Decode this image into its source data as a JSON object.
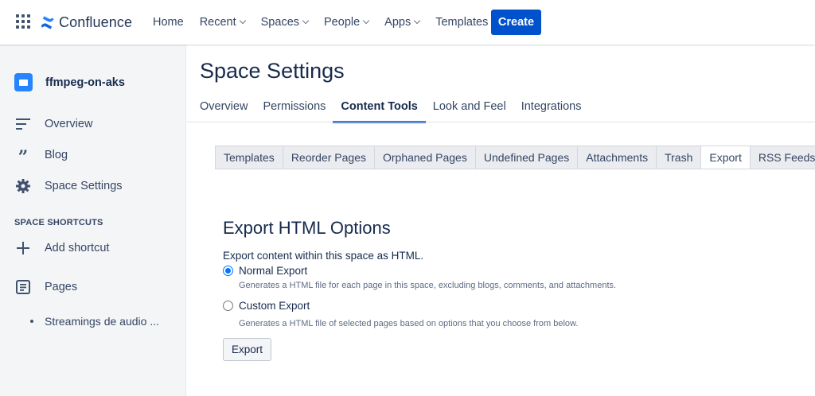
{
  "header": {
    "app_name": "Confluence",
    "nav": [
      {
        "label": "Home",
        "dropdown": false
      },
      {
        "label": "Recent",
        "dropdown": true
      },
      {
        "label": "Spaces",
        "dropdown": true
      },
      {
        "label": "People",
        "dropdown": true
      },
      {
        "label": "Apps",
        "dropdown": true
      },
      {
        "label": "Templates",
        "dropdown": false
      }
    ],
    "create_label": "Create",
    "accent": "#0052CC"
  },
  "sidebar": {
    "space_name": "ffmpeg-on-aks",
    "items": [
      {
        "label": "Overview",
        "icon": "overview-icon"
      },
      {
        "label": "Blog",
        "icon": "quote-icon"
      },
      {
        "label": "Space Settings",
        "icon": "gear-icon"
      }
    ],
    "shortcuts_heading": "SPACE SHORTCUTS",
    "add_shortcut": "Add shortcut",
    "pages_label": "Pages",
    "pages": [
      "Streamings de audio ..."
    ]
  },
  "main": {
    "title": "Space Settings",
    "tabs": [
      {
        "label": "Overview",
        "active": false
      },
      {
        "label": "Permissions",
        "active": false
      },
      {
        "label": "Content Tools",
        "active": true
      },
      {
        "label": "Look and Feel",
        "active": false
      },
      {
        "label": "Integrations",
        "active": false
      }
    ],
    "subtabs": [
      {
        "label": "Templates",
        "active": false
      },
      {
        "label": "Reorder Pages",
        "active": false
      },
      {
        "label": "Orphaned Pages",
        "active": false
      },
      {
        "label": "Undefined Pages",
        "active": false
      },
      {
        "label": "Attachments",
        "active": false
      },
      {
        "label": "Trash",
        "active": false
      },
      {
        "label": "Export",
        "active": true
      },
      {
        "label": "RSS Feeds",
        "active": false
      }
    ],
    "export": {
      "heading": "Export HTML Options",
      "description": "Export content within this space as HTML.",
      "options": [
        {
          "label": "Normal Export",
          "hint": "Generates a HTML file for each page in this space, excluding blogs, comments, and attachments.",
          "checked": true
        },
        {
          "label": "Custom Export",
          "hint": "Generates a HTML file of selected pages based on options that you choose from below.",
          "checked": false
        }
      ],
      "button_label": "Export"
    }
  }
}
